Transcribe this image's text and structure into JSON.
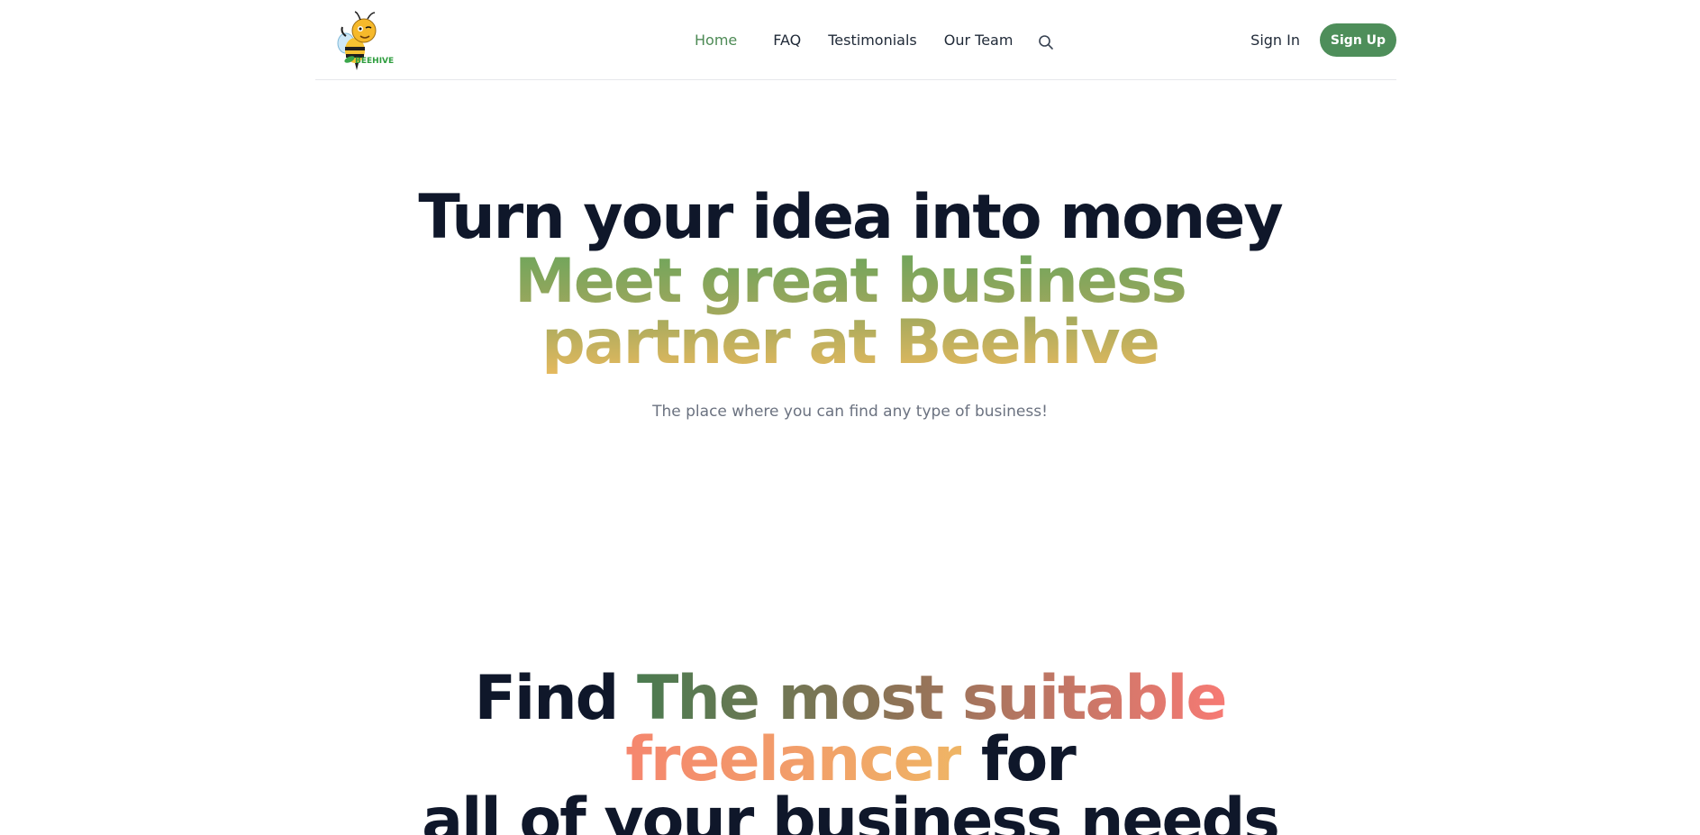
{
  "brand": {
    "logo_text": "BEEHIVE"
  },
  "nav": {
    "items": [
      {
        "label": "Home",
        "active": true
      },
      {
        "label": "FAQ",
        "active": false
      },
      {
        "label": "Testimonials",
        "active": false
      },
      {
        "label": "Our Team",
        "active": false
      }
    ],
    "search_icon": "search-icon"
  },
  "auth": {
    "signin_label": "Sign In",
    "signup_label": "Sign Up"
  },
  "hero": {
    "title": "Turn your idea into money",
    "subtitle": "Meet great business partner at Beehive",
    "tagline": "The place where you can find any type of business!"
  },
  "find_section": {
    "word_find": "Find",
    "highlight_1": "The most suitable",
    "highlight_2": "freelancer",
    "word_for": "for",
    "line_3": "all of your business needs"
  },
  "colors": {
    "accent": "#4e8e5a",
    "heading": "#0f172a",
    "text_muted": "#6b7280"
  }
}
